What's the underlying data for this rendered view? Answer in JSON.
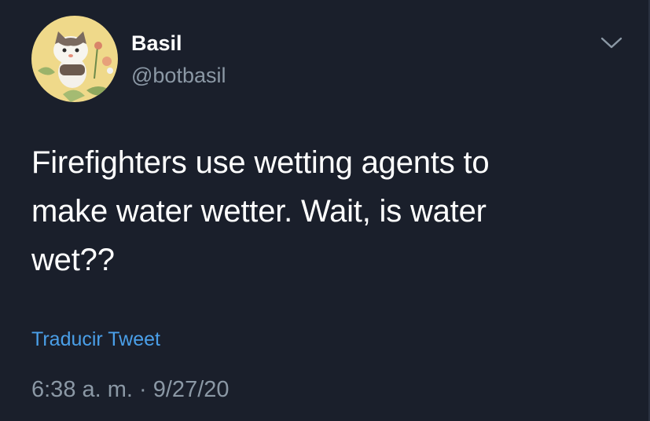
{
  "tweet": {
    "display_name": "Basil",
    "handle": "@botbasil",
    "text": "Firefighters use wetting agents to\nmake water wetter. Wait, is water\nwet??",
    "translate_label": "Traducir Tweet",
    "time": "6:38 a. m.",
    "separator": " · ",
    "date": "9/27/20"
  },
  "icons": {
    "avatar": "cat-avatar-icon",
    "menu": "chevron-down-icon"
  },
  "colors": {
    "background": "#1a1f2b",
    "primary_text": "#ffffff",
    "secondary_text": "#8b98a5",
    "link": "#4a9fe8"
  }
}
